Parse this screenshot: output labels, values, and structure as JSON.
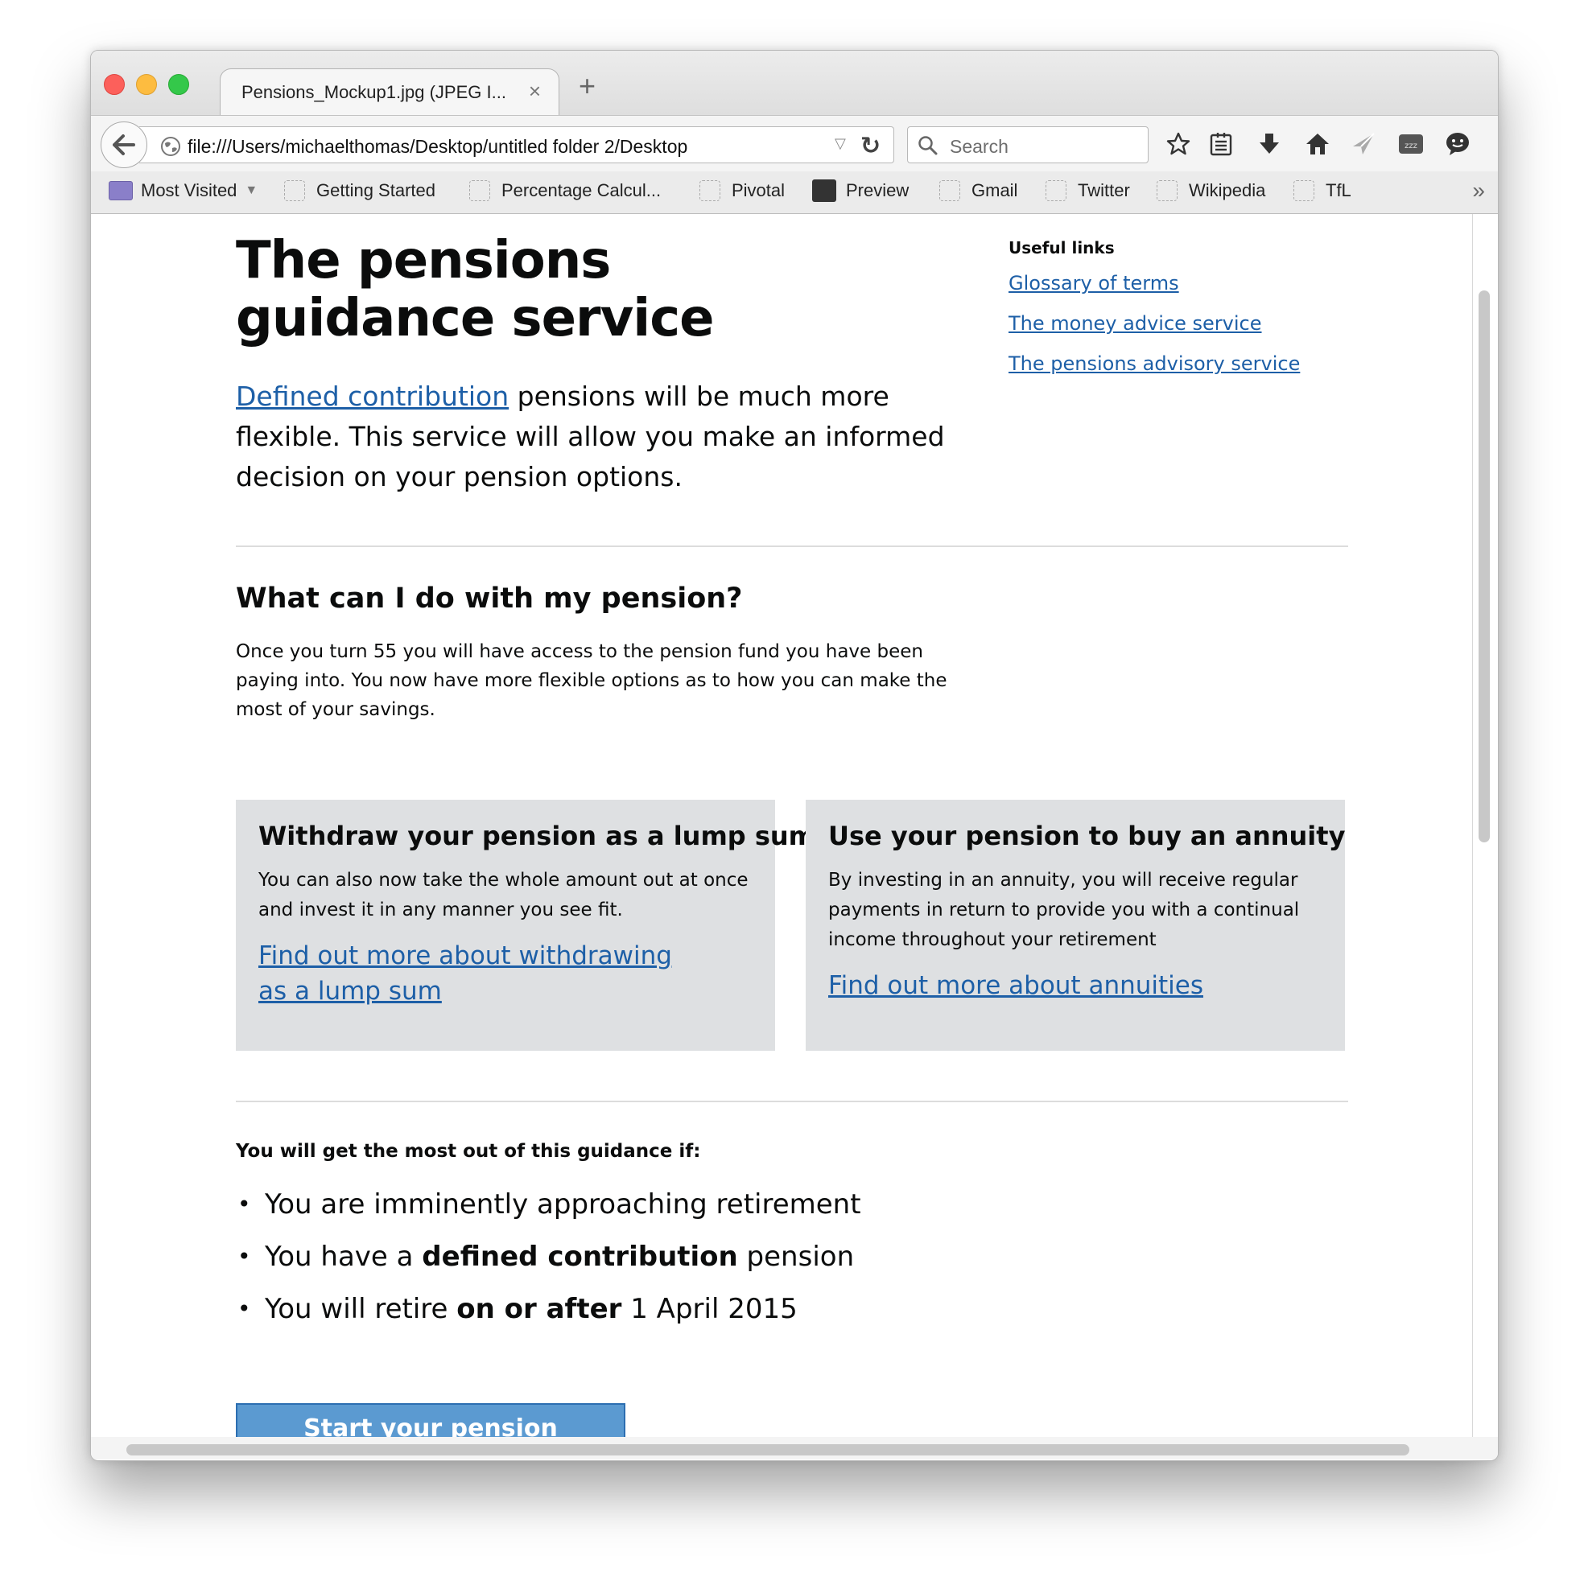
{
  "browser": {
    "tab_title": "Pensions_Mockup1.jpg (JPEG I...",
    "tab_close": "×",
    "new_tab": "+",
    "url": "file:///Users/michaelthomas/Desktop/untitled folder 2/Desktop",
    "search_placeholder": "Search",
    "toolbar_icons": [
      "star-icon",
      "reading-list-icon",
      "download-icon",
      "home-icon",
      "send-icon",
      "zzz-icon",
      "chat-icon",
      "menu-icon"
    ],
    "bookmarks": [
      {
        "label": "Most Visited",
        "icon": "folder-icon"
      },
      {
        "label": "Getting Started"
      },
      {
        "label": "Percentage Calcul..."
      },
      {
        "label": "Pivotal"
      },
      {
        "label": "Preview"
      },
      {
        "label": "Gmail"
      },
      {
        "label": "Twitter"
      },
      {
        "label": "Wikipedia"
      },
      {
        "label": "TfL"
      }
    ]
  },
  "page": {
    "title": "The pensions guidance service",
    "lead": {
      "link_text": "Defined contribution",
      "rest": " pensions will be much more flexible. This service will allow you make an informed decision on your pension options."
    },
    "useful_links": {
      "heading": "Useful links",
      "items": [
        "Glossary of terms",
        "The money advice service",
        "The pensions advisory service"
      ]
    },
    "section": {
      "title": "What can I do with my pension?",
      "body": "Once you turn 55 you will have access to the pension fund you have been paying into. You now have more flexible options as to how you can make the most of your savings."
    },
    "cards": [
      {
        "title": "Withdraw your pension as a lump sum",
        "body": "You can also now take the whole amount out at once and invest it in any manner you see fit.",
        "link": "Find out more about withdrawing as a lump sum"
      },
      {
        "title": "Use your pension to buy an annuity",
        "body": "By investing in an annuity, you will receive regular payments in return to provide you with a continual income throughout your retirement",
        "link": "Find out more about annuities"
      }
    ],
    "guidance": {
      "heading": "You will get the most out of this guidance if:",
      "bullets": [
        {
          "pre": "You are imminently approaching retirement",
          "bold": "",
          "post": ""
        },
        {
          "pre": "You have a ",
          "bold": "defined contribution",
          "post": " pension"
        },
        {
          "pre": "You will retire ",
          "bold": "on or after",
          "post": " 1 April 2015"
        }
      ]
    },
    "start_button": "Start your pension guidance"
  }
}
